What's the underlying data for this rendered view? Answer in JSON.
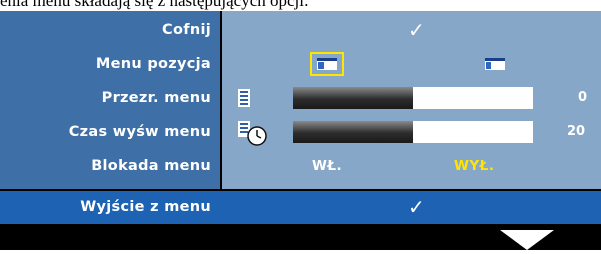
{
  "caption": "enia menu składają się z następujących opcji:",
  "menu": {
    "back_label": "Cofnij",
    "back_check": "✓",
    "position_label": "Menu pozycja",
    "transparency_label": "Przezr. menu",
    "transparency_value": "0",
    "transparency_fill_percent": 50,
    "timeout_label": "Czas wyśw menu",
    "timeout_value": "20",
    "timeout_fill_percent": 50,
    "lock_label": "Blokada menu",
    "lock_on": "WŁ.",
    "lock_off": "WYŁ.",
    "exit_label": "Wyjście z menu",
    "exit_check": "✓"
  },
  "colors": {
    "label_panel": "#3e6fa6",
    "content_panel": "#87a7c9",
    "highlight": "#1e63b3",
    "selected_option": "#ffe600"
  },
  "icons": [
    "position-left-icon",
    "position-right-icon",
    "transparency-icon",
    "clock-icon",
    "down-arrow-icon"
  ]
}
